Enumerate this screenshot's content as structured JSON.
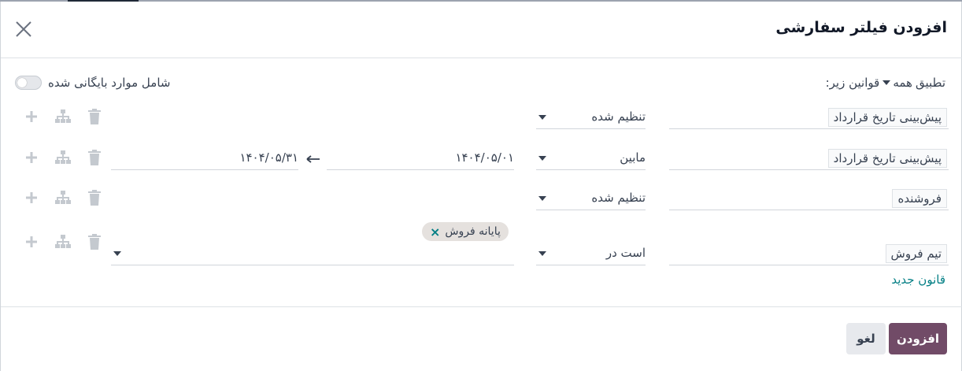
{
  "dialog": {
    "title": "افزودن فیلتر سفارشی"
  },
  "rules_header": {
    "apply_prefix": "تطبیق",
    "match_option": "همه",
    "apply_suffix": "قوانین زیر:",
    "archive_label": "شامل موارد بایگانی شده"
  },
  "rules": [
    {
      "field": "پیش‌بینی تاریخ قرارداد",
      "operator": "تنظیم شده"
    },
    {
      "field": "پیش‌بینی تاریخ قرارداد",
      "operator": "مابین",
      "value_from": "۱۴۰۴/۰۵/۰۱",
      "value_to": "۱۴۰۴/۰۵/۳۱"
    },
    {
      "field": "فروشنده",
      "operator": "تنظیم شده"
    },
    {
      "field": "تیم فروش",
      "operator": "است در",
      "tag": "پایانه فروش"
    }
  ],
  "new_rule": "قانون جدید",
  "footer": {
    "add_label": "افزودن",
    "cancel_label": "لغو"
  },
  "colors": {
    "primary": "#714b67",
    "link": "#017e84"
  },
  "icons": [
    "close-icon",
    "trash-icon",
    "hierarchy-icon",
    "plus-icon",
    "chevron-down-icon",
    "arrow-left-icon"
  ]
}
